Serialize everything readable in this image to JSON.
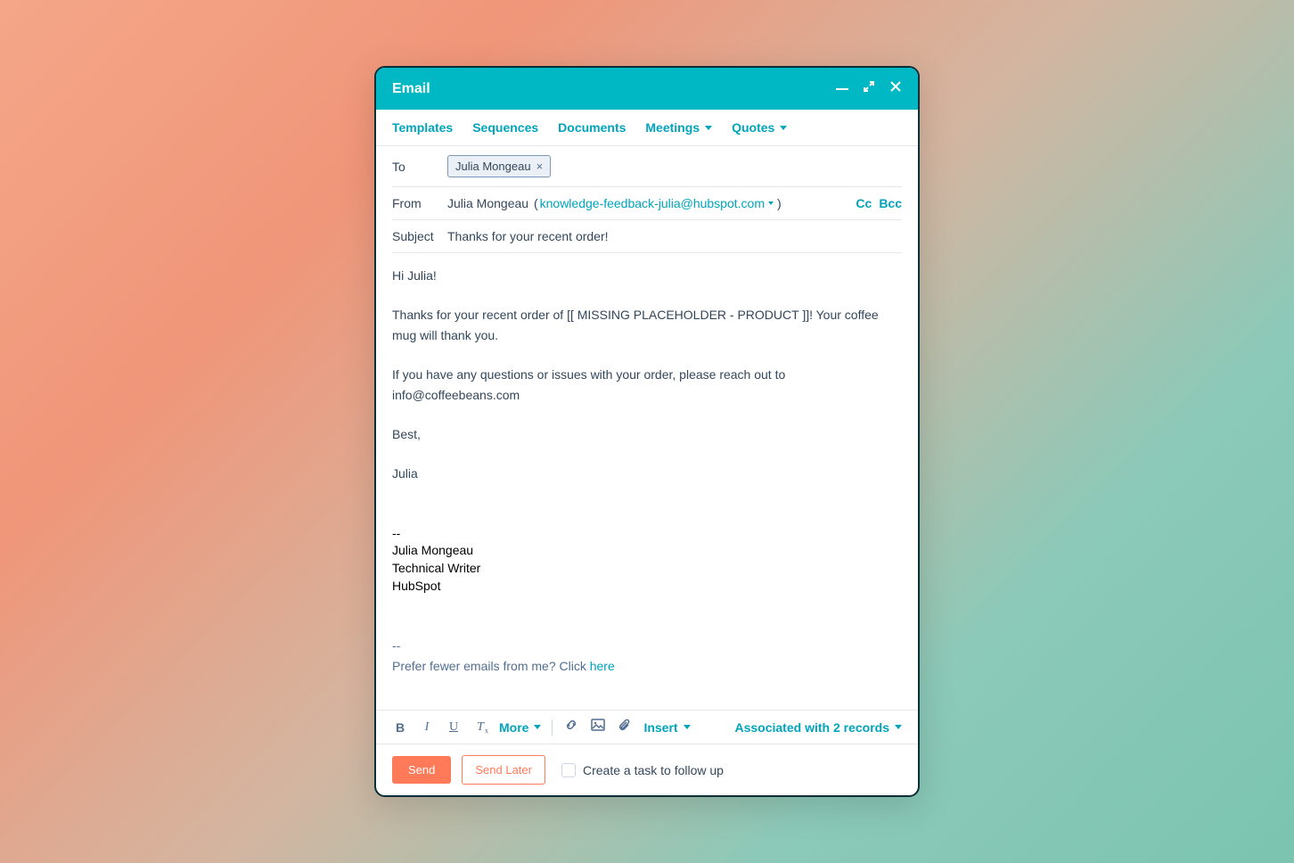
{
  "window": {
    "title": "Email"
  },
  "toolbar": {
    "templates": "Templates",
    "sequences": "Sequences",
    "documents": "Documents",
    "meetings": "Meetings",
    "quotes": "Quotes"
  },
  "fields": {
    "to_label": "To",
    "to_chip": "Julia Mongeau",
    "from_label": "From",
    "from_name": "Julia Mongeau",
    "from_email": "knowledge-feedback-julia@hubspot.com",
    "cc": "Cc",
    "bcc": "Bcc",
    "subject_label": "Subject",
    "subject_value": "Thanks for your recent order!"
  },
  "body": {
    "greeting": "Hi Julia!",
    "p1": "Thanks for your recent order of [[ MISSING PLACEHOLDER - PRODUCT ]]! Your coffee mug will thank you.",
    "p2": "If you have any questions or issues with your order, please reach out to info@coffeebeans.com",
    "closing": "Best,",
    "name": "Julia",
    "sig_sep": "--",
    "sig_name": "Julia Mongeau",
    "sig_title": "Technical Writer",
    "sig_company": "HubSpot",
    "unsub_sep": "--",
    "unsub_text": "Prefer fewer emails from me? Click ",
    "unsub_link": "here"
  },
  "format": {
    "more": "More",
    "insert": "Insert",
    "associated": "Associated with 2 records"
  },
  "actions": {
    "send": "Send",
    "send_later": "Send Later",
    "task": "Create a task to follow up"
  }
}
